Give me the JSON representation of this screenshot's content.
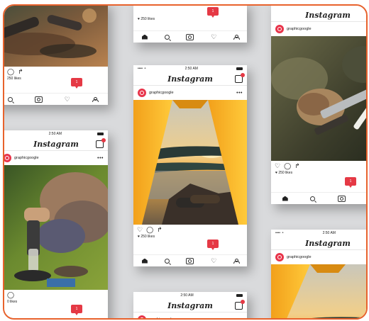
{
  "app": {
    "brand": "Instagram",
    "username": "graphicgoogle",
    "more": "•••"
  },
  "status": {
    "carrier": "•••• ⚬",
    "time": "2:50 AM"
  },
  "posts": {
    "top_left": {
      "likes": "250 likes",
      "notif": "1"
    },
    "top_center": {
      "likes": "250 likes",
      "notif": "1"
    },
    "center": {
      "likes": "♥ 250 likes",
      "notif": "1"
    },
    "right": {
      "likes": "♥ 250 likes",
      "notif": "1"
    },
    "bottom_left": {
      "likes": "0 likes",
      "notif": "1"
    }
  },
  "icons": {
    "like": "heart-outline",
    "comment": "comment-icon",
    "share": "share-icon",
    "home": "home-icon",
    "search": "search-icon",
    "camera": "camera-icon",
    "activity": "heart-icon",
    "profile": "profile-icon"
  },
  "glyphs": {
    "heart": "♡",
    "comment": "◯",
    "share": "↱"
  },
  "colors": {
    "accent": "#e53945",
    "frame": "#e8622c",
    "avatar": "#e8344a"
  }
}
